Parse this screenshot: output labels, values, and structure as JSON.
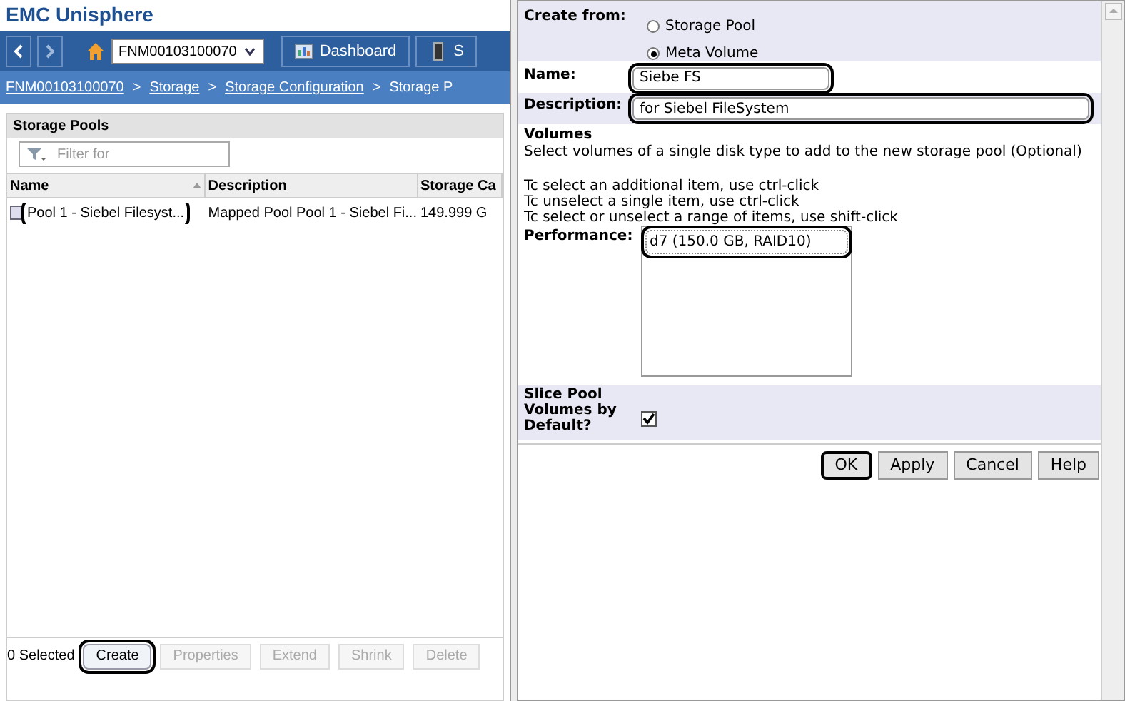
{
  "app_title": "EMC Unisphere",
  "nav": {
    "system": "FNM00103100070",
    "tabs": [
      {
        "label": "Dashboard"
      },
      {
        "label": "S"
      }
    ]
  },
  "breadcrumb": [
    {
      "label": "FNM00103100070",
      "link": true
    },
    {
      "label": ">",
      "link": false
    },
    {
      "label": "Storage",
      "link": true
    },
    {
      "label": ">",
      "link": false
    },
    {
      "label": "Storage Configuration",
      "link": true
    },
    {
      "label": ">",
      "link": false
    },
    {
      "label": "Storage P",
      "link": false
    }
  ],
  "panel": {
    "title": "Storage Pools",
    "filter_placeholder": "Filter for",
    "columns": [
      "Name",
      "Description",
      "Storage Ca"
    ],
    "rows": [
      {
        "cells": [
          "Pool 1 - Siebel Filesyst...",
          "Mapped Pool Pool 1 - Siebel Fi...",
          "149.999 G"
        ],
        "highlighted": true
      }
    ],
    "selected_count": "0 Selected",
    "buttons": [
      {
        "label": "Create",
        "disabled": false,
        "highlighted": true
      },
      {
        "label": "Properties",
        "disabled": true,
        "highlighted": false
      },
      {
        "label": "Extend",
        "disabled": true,
        "highlighted": false
      },
      {
        "label": "Shrink",
        "disabled": true,
        "highlighted": false
      },
      {
        "label": "Delete",
        "disabled": true,
        "highlighted": false
      }
    ]
  },
  "dialog": {
    "create_from": {
      "label": "Create from:",
      "options": [
        {
          "label": "Storage Pool",
          "selected": false
        },
        {
          "label": "Meta Volume",
          "selected": true
        }
      ]
    },
    "name": {
      "label": "Name:",
      "value": "Siebe FS",
      "highlighted": true
    },
    "description": {
      "label": "Description:",
      "value": "for Siebel FileSystem",
      "highlighted": true
    },
    "volumes_title": "Volumes",
    "volumes_help": "Select volumes of a single disk type to add to the new storage pool (Optional)",
    "hints": [
      "Tc select an additional item, use ctrl-click",
      "Tc unselect a single item, use ctrl-click",
      "Tc select or unselect a range of items, use shift-click"
    ],
    "performance": {
      "label": "Performance:",
      "items": [
        {
          "label": "d7 (150.0 GB, RAID10)",
          "highlighted": true
        }
      ]
    },
    "slice": {
      "label": "Slice Pool Volumes by Default?",
      "checked": true
    },
    "buttons": [
      {
        "label": "OK",
        "highlighted": true
      },
      {
        "label": "Apply",
        "highlighted": false
      },
      {
        "label": "Cancel",
        "highlighted": false
      },
      {
        "label": "Help",
        "highlighted": false
      }
    ]
  }
}
